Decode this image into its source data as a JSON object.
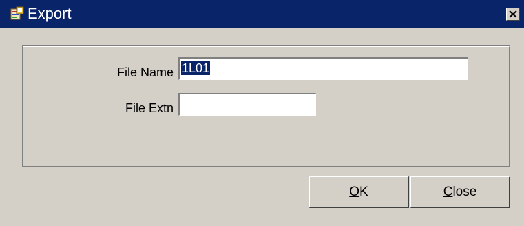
{
  "window": {
    "title": "Export",
    "title_icon": "app-form-icon",
    "close_icon": "close-x-icon"
  },
  "form": {
    "file_name_label": "File Name",
    "file_name_value": "1L01",
    "file_extn_label": "File Extn",
    "file_extn_value": ""
  },
  "buttons": {
    "ok_mnemonic": "O",
    "ok_rest": "K",
    "close_mnemonic": "C",
    "close_rest": "lose"
  },
  "colors": {
    "titlebar": "#0a246a",
    "face": "#d4d0c8",
    "selection": "#0a246a"
  }
}
